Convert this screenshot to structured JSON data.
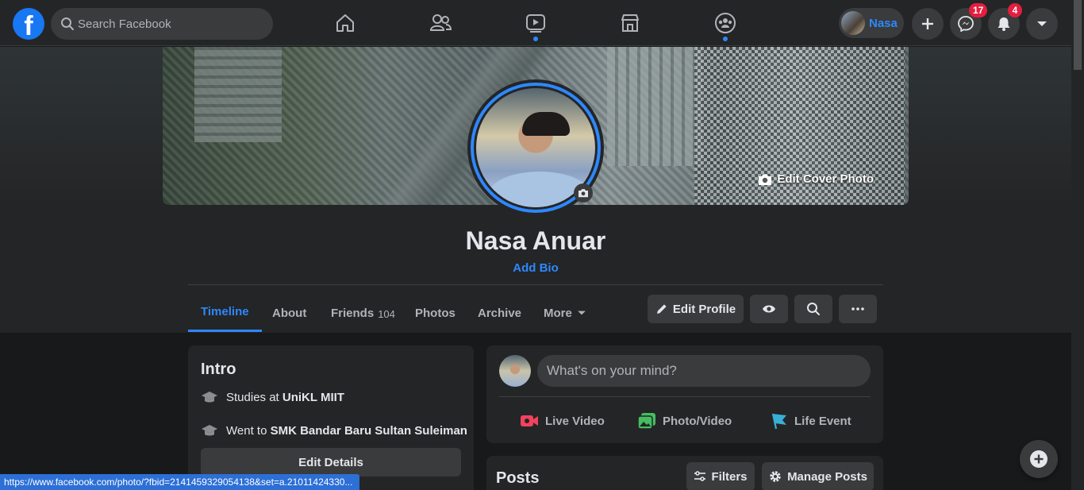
{
  "topnav": {
    "logo_letter": "f",
    "search_placeholder": "Search Facebook",
    "tabs": [
      {
        "icon": "home-icon",
        "active": false
      },
      {
        "icon": "friends-icon",
        "active": false
      },
      {
        "icon": "watch-icon",
        "active": true
      },
      {
        "icon": "marketplace-icon",
        "active": false
      },
      {
        "icon": "groups-icon",
        "active": true
      }
    ],
    "profile_name": "Nasa",
    "messenger_count": "17",
    "notifications_count": "4"
  },
  "profile": {
    "edit_cover_label": "Edit Cover Photo",
    "name": "Nasa Anuar",
    "bio_link": "Add Bio",
    "tabs": [
      {
        "label": "Timeline",
        "active": true
      },
      {
        "label": "About"
      },
      {
        "label": "Friends",
        "count": "104"
      },
      {
        "label": "Photos"
      },
      {
        "label": "Archive"
      },
      {
        "label": "More"
      }
    ],
    "edit_profile_label": "Edit Profile"
  },
  "intro": {
    "title": "Intro",
    "studies_prefix": "Studies at ",
    "studies_school": "UniKL MIIT",
    "went_prefix": "Went to ",
    "went_school": "SMK Bandar Baru Sultan Suleiman",
    "edit_details_label": "Edit Details"
  },
  "composer": {
    "placeholder": "What's on your mind?",
    "actions": [
      {
        "label": "Live Video",
        "color": "#f3425f"
      },
      {
        "label": "Photo/Video",
        "color": "#45bd62"
      },
      {
        "label": "Life Event",
        "color": "#39afd5"
      }
    ]
  },
  "posts": {
    "title": "Posts",
    "filters_label": "Filters",
    "manage_label": "Manage Posts"
  },
  "statusbar": {
    "url": "https://www.facebook.com/photo/?fbid=2141459329054138&set=a.21011424330..."
  },
  "colors": {
    "accent": "#2d88ff",
    "badge": "#e41e3f",
    "background": "#18191a",
    "surface": "#242526"
  }
}
